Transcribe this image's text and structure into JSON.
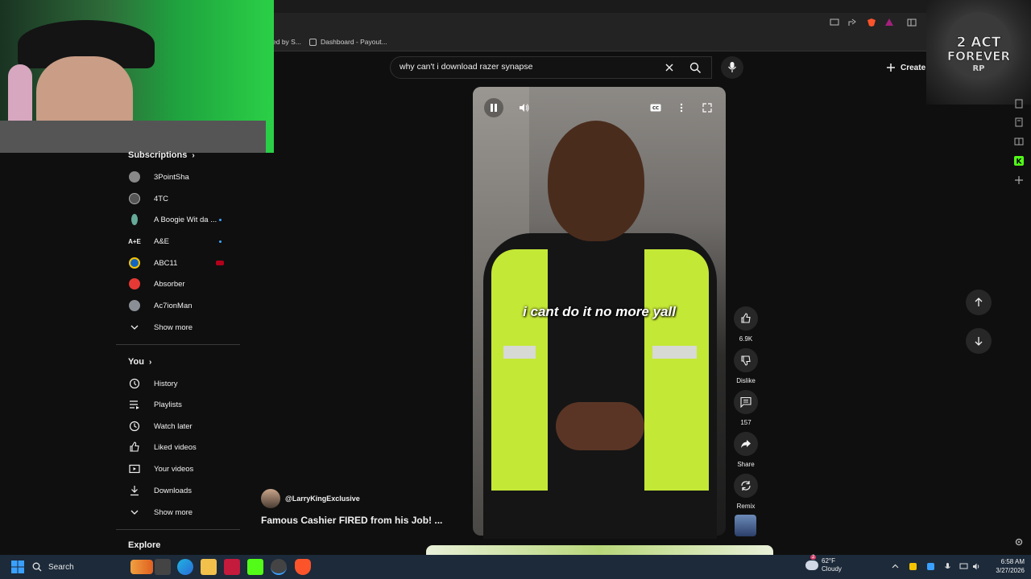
{
  "browser": {
    "bookmarks": [
      {
        "label": "ed by S..."
      },
      {
        "label": "Dashboard - Payout..."
      }
    ]
  },
  "search": {
    "query": "why can't i download razer synapse",
    "clear_icon": "close-icon",
    "search_icon": "search-icon",
    "mic_icon": "mic-icon"
  },
  "header": {
    "create_label": "Create"
  },
  "sidebar": {
    "subscriptions_title": "Subscriptions",
    "subscriptions": [
      {
        "label": "3PointSha",
        "new": false
      },
      {
        "label": "4TC",
        "new": false
      },
      {
        "label": "A Boogie Wit da ...",
        "new": true
      },
      {
        "label": "A&E",
        "new": true
      },
      {
        "label": "ABC11",
        "new": false,
        "live": true
      },
      {
        "label": "Absorber",
        "new": false
      },
      {
        "label": "Ac7ionMan",
        "new": false
      }
    ],
    "show_more_1": "Show more",
    "you_title": "You",
    "you_items": [
      {
        "label": "History",
        "icon": "history-icon"
      },
      {
        "label": "Playlists",
        "icon": "playlists-icon"
      },
      {
        "label": "Watch later",
        "icon": "watch-later-icon"
      },
      {
        "label": "Liked videos",
        "icon": "like-icon"
      },
      {
        "label": "Your videos",
        "icon": "your-videos-icon"
      },
      {
        "label": "Downloads",
        "icon": "download-icon"
      }
    ],
    "show_more_2": "Show more",
    "explore_title": "Explore"
  },
  "video": {
    "caption": "i cant do it no more yall",
    "channel": "@LarryKingExclusive",
    "title": "Famous Cashier FIRED from his Job! ..."
  },
  "actions": {
    "like_count": "6.9K",
    "dislike_label": "Dislike",
    "comment_count": "157",
    "share_label": "Share",
    "remix_label": "Remix"
  },
  "taskbar": {
    "search_label": "Search",
    "weather_temp": "62°F",
    "weather_cond": "Cloudy",
    "weather_badge": "2",
    "time": "6:58 AM",
    "date": "3/27/2026"
  },
  "colors": {
    "background": "#0f0f0f",
    "accent_blue": "#3ea6ff",
    "vest_yellow": "#c4e836"
  }
}
